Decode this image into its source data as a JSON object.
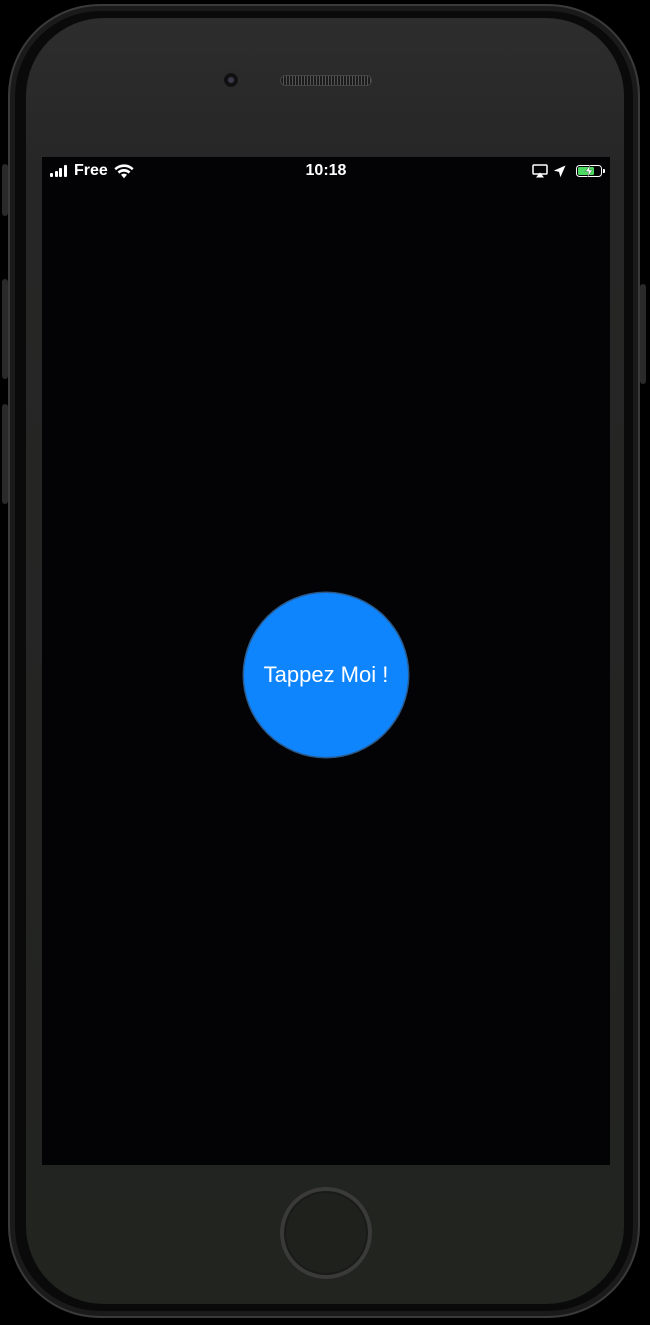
{
  "status_bar": {
    "carrier": "Free",
    "time": "10:18",
    "signal_icon": "cellular-signal-icon",
    "wifi_icon": "wifi-icon",
    "airplay_icon": "screen-mirroring-icon",
    "location_icon": "location-arrow-icon",
    "battery_icon": "battery-charging-icon",
    "battery_level": 0.8,
    "battery_color": "#4cd964"
  },
  "main": {
    "button_label": "Tappez Moi !",
    "button_color": "#0e84fd",
    "background_color": "#030205"
  },
  "device": {
    "home_button_icon": "home-button-icon",
    "speaker_icon": "earpiece-speaker-icon",
    "camera_icon": "front-camera-icon"
  }
}
